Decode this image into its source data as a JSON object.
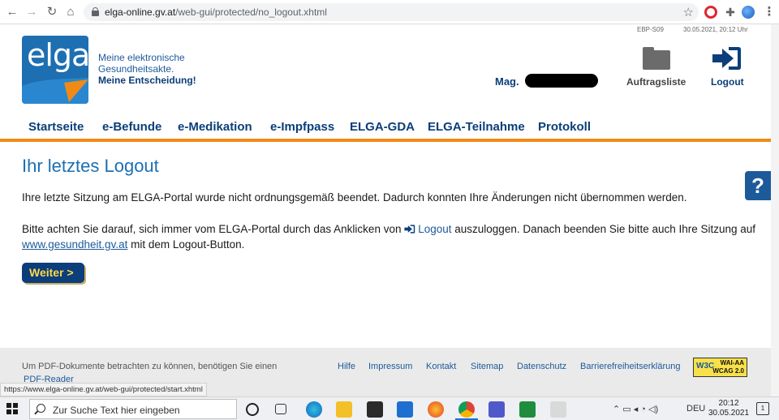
{
  "browser": {
    "url_host": "elga-online.gv.at",
    "url_path": "/web-gui/protected/no_logout.xhtml",
    "status_url": "https://www.elga-online.gv.at/web-gui/protected/start.xhtml"
  },
  "header": {
    "page_code": "EBP-S09",
    "timestamp": "30.05.2021, 20:12 Uhr",
    "logo_text": "elga",
    "tagline_line1": "Meine elektronische",
    "tagline_line2": "Gesundheitsakte.",
    "tagline_line3": "Meine Entscheidung!",
    "user_prefix": "Mag.",
    "folder_label": "Auftragsliste",
    "logout_label": "Logout"
  },
  "nav": {
    "items": [
      "Startseite",
      "e-Befunde",
      "e-Medikation",
      "e-Impfpass",
      "ELGA-GDA",
      "ELGA-Teilnahme",
      "Protokoll"
    ]
  },
  "content": {
    "title": "Ihr letztes Logout",
    "para1": "Ihre letzte Sitzung am ELGA-Portal wurde nicht ordnungsgemäß beendet. Dadurch konnten Ihre Änderungen nicht übernommen werden.",
    "para2_before": "Bitte achten Sie darauf, sich immer vom ELGA-Portal durch das Anklicken von ",
    "para2_logout": "Logout",
    "para2_middle": " auszuloggen. Danach beenden Sie bitte auch Ihre Sitzung auf ",
    "para2_link": "www.gesundheit.gv.at",
    "para2_after": " mit dem Logout-Button.",
    "button_label": "Weiter >",
    "help_label": "?"
  },
  "footer": {
    "text": "Um PDF-Dokumente betrachten zu können, benötigen Sie einen",
    "pdf_link": "PDF-Reader",
    "links": [
      "Hilfe",
      "Impressum",
      "Kontakt",
      "Sitemap",
      "Datenschutz",
      "Barrierefreiheitserklärung"
    ],
    "badge_line1": "WAI-AA",
    "badge_line2": "WCAG 2.0",
    "badge_w3c": "W3C"
  },
  "taskbar": {
    "search_placeholder": "Zur Suche Text hier eingeben",
    "language": "DEU",
    "time": "20:12",
    "date": "30.05.2021",
    "notification_count": "1"
  },
  "colors": {
    "brand_blue": "#1d6fb2",
    "navy": "#0b3e7a",
    "orange": "#f08a17",
    "button_text": "#ffd84a"
  }
}
